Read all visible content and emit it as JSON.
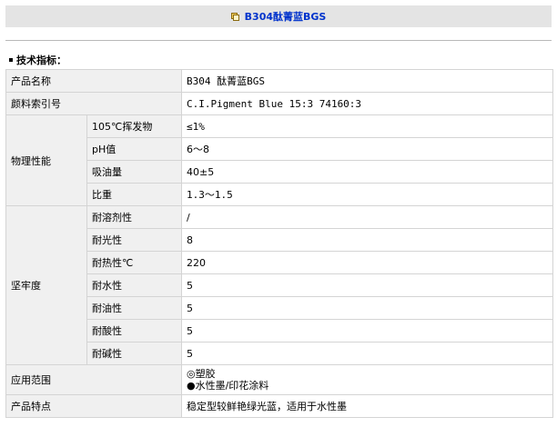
{
  "title": "B304酞菁蓝BGS",
  "section_heading": "技术指标：",
  "rows": {
    "product_name": {
      "label": "产品名称",
      "value": "B304 酞菁蓝BGS"
    },
    "pigment_index": {
      "label": "颜料索引号",
      "value": "C.I.Pigment Blue 15:3 74160:3"
    },
    "physical": {
      "label": "物理性能",
      "items": [
        {
          "label": "105℃挥发物",
          "value": "≤1%"
        },
        {
          "label": "pH值",
          "value": "6～8"
        },
        {
          "label": "吸油量",
          "value": "40±5"
        },
        {
          "label": "比重",
          "value": "1.3～1.5"
        }
      ]
    },
    "fastness": {
      "label": "坚牢度",
      "items": [
        {
          "label": "耐溶剂性",
          "value": "/"
        },
        {
          "label": "耐光性",
          "value": "8"
        },
        {
          "label": "耐热性℃",
          "value": "220"
        },
        {
          "label": "耐水性",
          "value": "5"
        },
        {
          "label": "耐油性",
          "value": "5"
        },
        {
          "label": "耐酸性",
          "value": "5"
        },
        {
          "label": "耐碱性",
          "value": "5"
        }
      ]
    },
    "application": {
      "label": "应用范围",
      "line1": "◎塑胶",
      "line2": "●水性墨/印花涂料"
    },
    "features": {
      "label": "产品特点",
      "value": "稳定型较鲜艳绿光蓝，适用于水性墨"
    }
  }
}
